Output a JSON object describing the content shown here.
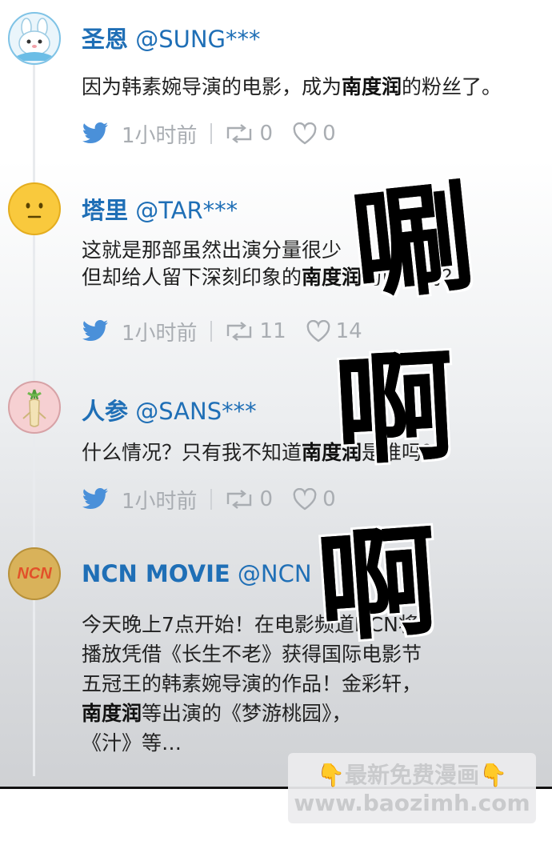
{
  "posts": [
    {
      "display_name": "圣恩",
      "handle": "@SUNG***",
      "lines": [
        [
          {
            "t": "因为韩素婉导演的电影，成为"
          },
          {
            "t": "南度润",
            "b": true
          },
          {
            "t": "的粉丝了。"
          }
        ]
      ],
      "time": "1小时前",
      "retweets": "0",
      "likes": "0",
      "avatar_icon": "bunny-avatar-icon"
    },
    {
      "display_name": "塔里",
      "handle": "@TAR***",
      "lines": [
        [
          {
            "t": "这就是那部虽然出演分量很少"
          }
        ],
        [
          {
            "t": "但却给人留下深刻印象的"
          },
          {
            "t": "南度润",
            "b": true
          },
          {
            "t": "的电影吗？"
          }
        ]
      ],
      "time": "1小时前",
      "retweets": "11",
      "likes": "14",
      "avatar_icon": "neutral-face-avatar-icon"
    },
    {
      "display_name": "人参",
      "handle": "@SANS***",
      "lines": [
        [
          {
            "t": "什么情况？只有我不知道"
          },
          {
            "t": "南度润",
            "b": true
          },
          {
            "t": "是谁吗？"
          }
        ]
      ],
      "time": "1小时前",
      "retweets": "0",
      "likes": "0",
      "avatar_icon": "ginseng-avatar-icon"
    },
    {
      "display_name": "NCN MOVIE",
      "handle": "@NCN",
      "lines": [
        [
          {
            "t": "今天晚上7点开始！在电影频道NCN将"
          }
        ],
        [
          {
            "t": "播放凭借《长生不老》获得国际电影节"
          }
        ],
        [
          {
            "t": "五冠王的韩素婉导演的作品！金彩轩，"
          }
        ],
        [
          {
            "t": "南度润",
            "b": true
          },
          {
            "t": "等出演的《梦游桃园》，"
          }
        ],
        [
          {
            "t": "《汁》等…"
          }
        ]
      ],
      "avatar_text": "NCN",
      "avatar_icon": "ncn-logo-avatar-icon"
    }
  ],
  "sfx": [
    "唰",
    "啊",
    "啊"
  ],
  "watermark": {
    "line1": "👇最新免费漫画👇",
    "line2": "www.baozimh.com"
  },
  "colors": {
    "name_blue": "#1f6fb6",
    "twitter_blue": "#4a90d9",
    "action_gray": "#a9adb2"
  }
}
